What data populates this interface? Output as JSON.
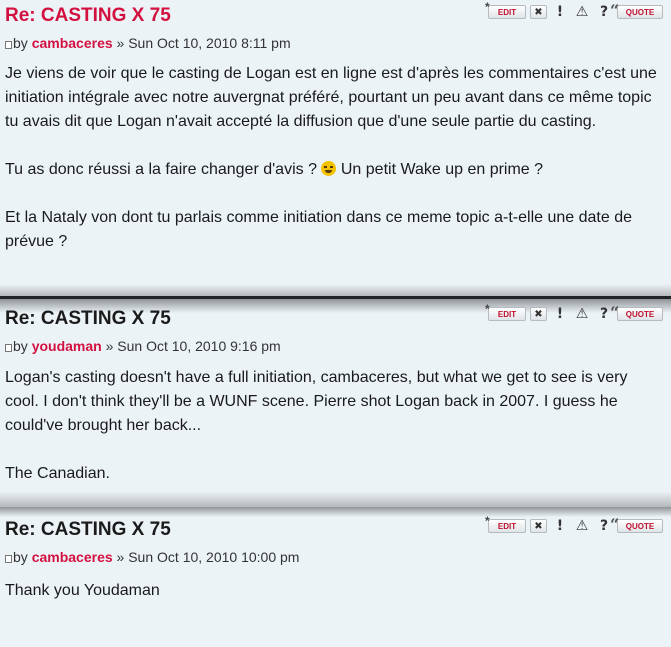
{
  "posts": [
    {
      "title": "Re: CASTING X 75",
      "by": "by",
      "author": "cambaceres",
      "sep": "»",
      "date": "Sun Oct 10, 2010 8:11 pm",
      "paragraphs": [
        "Je viens de voir que le casting de Logan est en ligne est d'après les commentaires c'est une initiation intégrale avec notre auvergnat préféré, pourtant un peu avant dans ce même topic tu avais dit que Logan n'avait accepté la diffusion que d'une seule partie du casting.",
        "Tu as donc réussi a la faire changer d'avis ?",
        "Un petit Wake up en prime ?",
        "Et la Nataly von dont tu parlais comme initiation dans ce meme topic a-t-elle une date de prévue ?"
      ]
    },
    {
      "title": "Re: CASTING X 75",
      "by": "by",
      "author": "youdaman",
      "sep": "»",
      "date": "Sun Oct 10, 2010 9:16 pm",
      "paragraphs": [
        "Logan's casting doesn't have a full initiation, cambaceres, but what we get to see is very cool. I don't think they'll be a WUNF scene. Pierre shot Logan back in 2007. I guess he could've brought her back...",
        "The Canadian."
      ]
    },
    {
      "title": "Re: CASTING X 75",
      "by": "by",
      "author": "cambaceres",
      "sep": "»",
      "date": "Sun Oct 10, 2010 10:00 pm",
      "paragraphs": [
        "Thank you Youdaman"
      ]
    }
  ],
  "tools": {
    "edit": "EDIT",
    "delete": "✖",
    "report": "!",
    "warn": "⚠",
    "info": "?",
    "quote": "QUOTE"
  },
  "colors": {
    "background": "#ecf3f7",
    "author": "#d31141",
    "title_first": "#d31141",
    "title_other": "#1b1b1b"
  },
  "icons": [
    "post-icon",
    "edit-icon",
    "delete-icon",
    "report-icon",
    "warning-icon",
    "info-icon",
    "quote-icon",
    "devil-smiley-icon"
  ]
}
